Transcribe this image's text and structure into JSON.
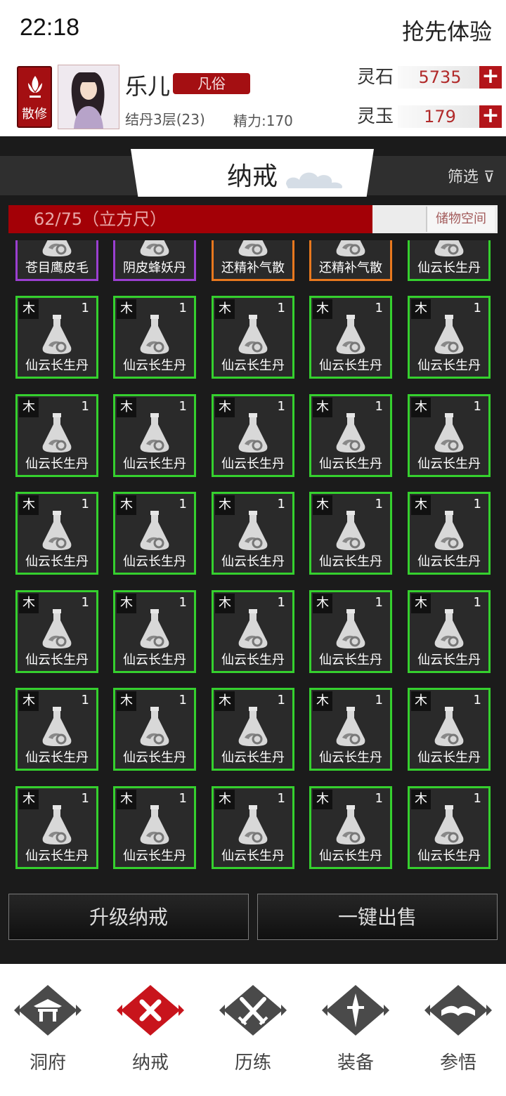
{
  "status": {
    "time": "22:18",
    "promo": "抢先体验"
  },
  "profile": {
    "sect": "散修",
    "name": "乐儿",
    "rank": "凡俗",
    "realm": "结丹3层(23)",
    "energy": "精力:170",
    "currencies": [
      {
        "name": "灵石",
        "value": "5735"
      },
      {
        "name": "灵玉",
        "value": "179"
      }
    ]
  },
  "panel": {
    "title": "纳戒",
    "filter": "筛选",
    "capacity": {
      "text": "62/75（立方尺）",
      "used": 62,
      "total": 75,
      "storage_label": "储物空间"
    },
    "partial_row": [
      {
        "name": "苍目鹰皮毛",
        "border": "purple"
      },
      {
        "name": "阴皮蜂妖丹",
        "border": "purple"
      },
      {
        "name": "还精补气散",
        "border": "orange"
      },
      {
        "name": "还精补气散",
        "border": "orange"
      },
      {
        "name": "仙云长生丹",
        "border": "green"
      }
    ],
    "item": {
      "element": "木",
      "qty": "1",
      "name": "仙云长生丹"
    },
    "buttons": {
      "upgrade": "升级纳戒",
      "sell_all": "一键出售"
    }
  },
  "nav": [
    {
      "label": "洞府",
      "icon": "pavilion-icon"
    },
    {
      "label": "纳戒",
      "icon": "ring-icon",
      "active": true
    },
    {
      "label": "历练",
      "icon": "crossed-swords-icon"
    },
    {
      "label": "装备",
      "icon": "dagger-icon"
    },
    {
      "label": "参悟",
      "icon": "book-icon"
    }
  ],
  "colors": {
    "accent_red": "#a40f12",
    "green_border": "#35d02e",
    "purple_border": "#9b3fd1",
    "orange_border": "#e8781e"
  }
}
